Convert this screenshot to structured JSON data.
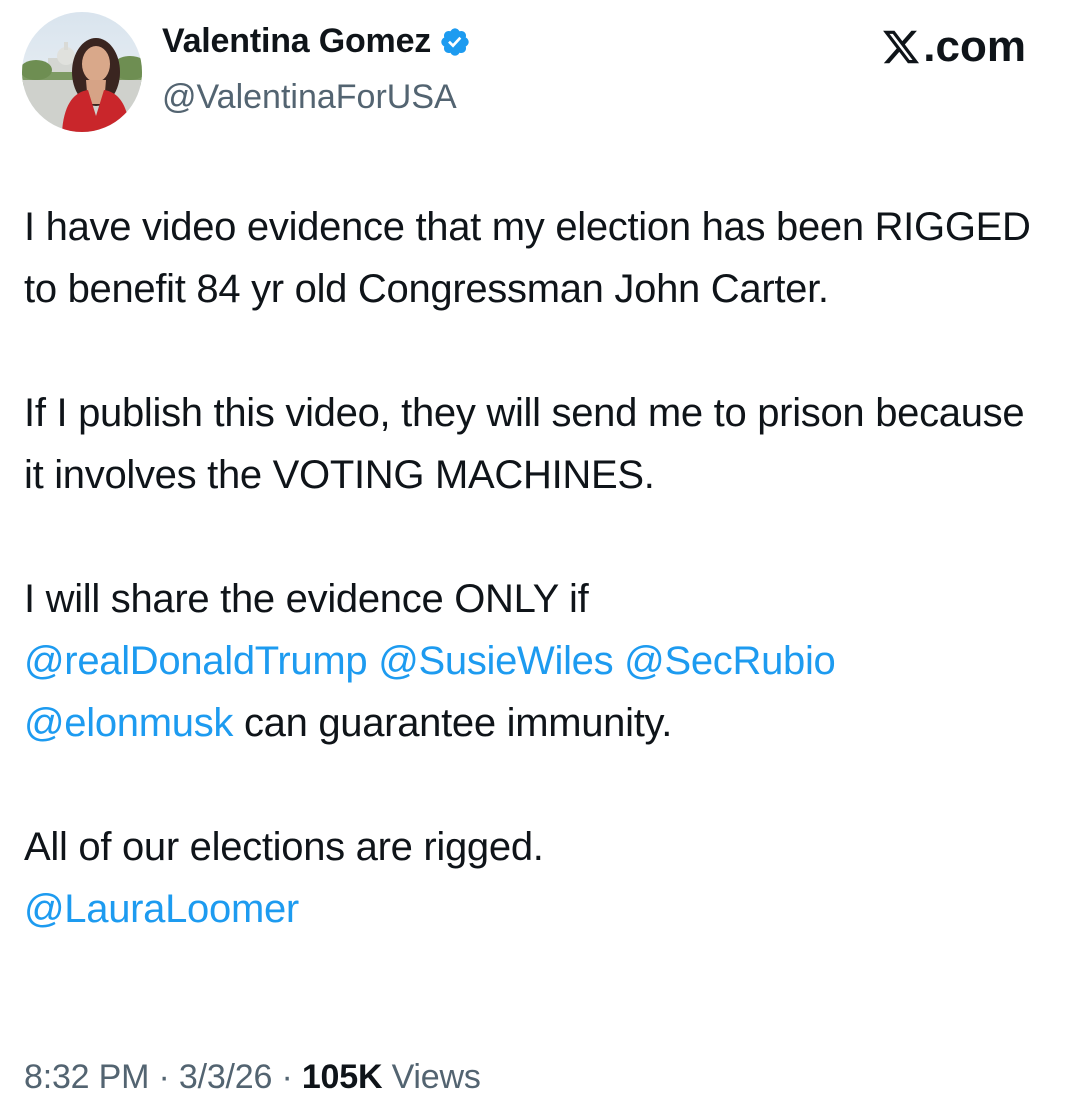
{
  "author": {
    "display_name": "Valentina Gomez",
    "handle": "@ValentinaForUSA",
    "verified_icon": "verified-badge-icon"
  },
  "brand": {
    "label": ".com",
    "logo_icon": "x-logo-icon"
  },
  "tweet": {
    "p1": "I have video evidence that my election has been RIGGED to benefit 84 yr old Congressman John Carter.",
    "p2": "If I publish this video, they will send me to prison because it involves the VOTING MACHINES.",
    "p3_lead": "I will share the evidence ONLY if",
    "p3_mentions": [
      "@realDonaldTrump",
      "@SusieWiles",
      "@SecRubio",
      "@elonmusk"
    ],
    "p3_tail": "can guarantee immunity.",
    "p4": "All of our elections are rigged.",
    "p4_mention": "@LauraLoomer"
  },
  "meta": {
    "time": "8:32 PM",
    "separator": "·",
    "date": "3/3/26",
    "views_count": "105K",
    "views_label": "Views"
  },
  "colors": {
    "mention": "#1d9bf0",
    "verified": "#1d9bf0",
    "secondary_text": "#536471",
    "primary_text": "#0f1419"
  }
}
